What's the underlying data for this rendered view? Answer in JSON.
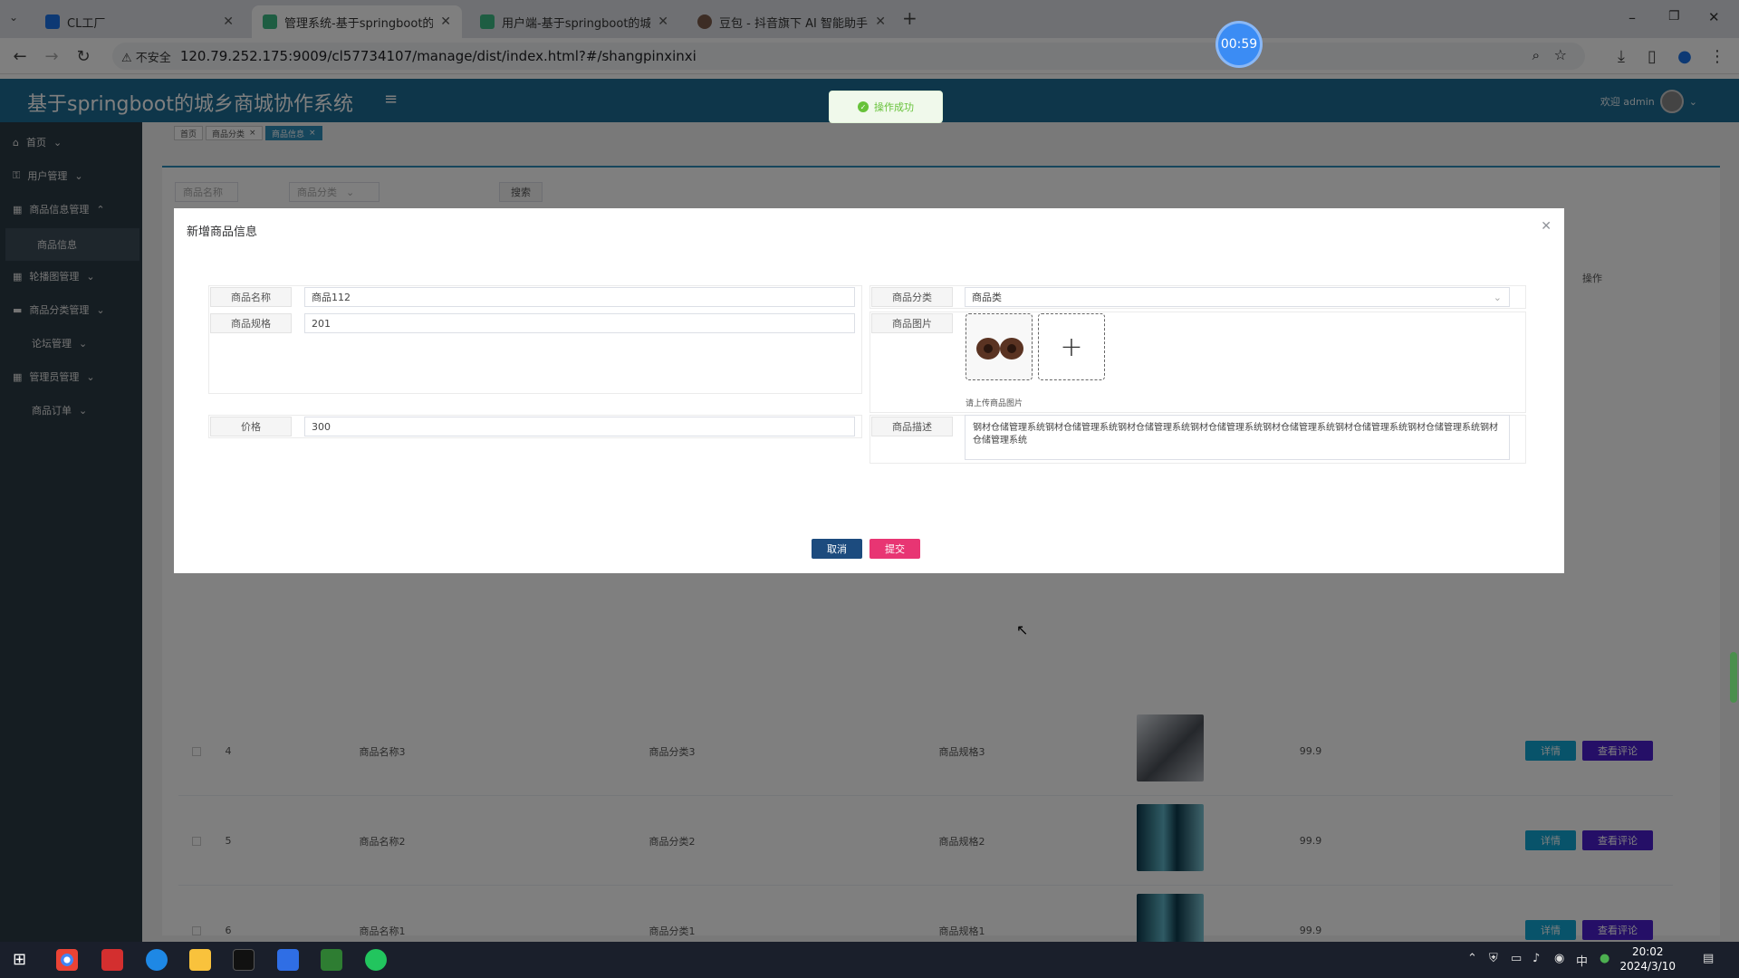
{
  "browser": {
    "tabs": [
      {
        "title": "CL工厂",
        "active": false
      },
      {
        "title": "管理系统-基于springboot的城",
        "active": true
      },
      {
        "title": "用户端-基于springboot的城乡",
        "active": false
      },
      {
        "title": "豆包 - 抖音旗下 AI 智能助手",
        "active": false
      }
    ],
    "security_label": "不安全",
    "url": "120.79.252.175:9009/cl57734107/manage/dist/index.html?#/shangpinxinxi",
    "timer": "00:59"
  },
  "app": {
    "title": "基于springboot的城乡商城协作系统",
    "welcome": "欢迎 admin"
  },
  "toast": {
    "message": "操作成功"
  },
  "sidebar": {
    "items": [
      {
        "label": "首页"
      },
      {
        "label": "用户管理"
      },
      {
        "label": "商品信息管理"
      },
      {
        "label": "商品信息"
      },
      {
        "label": "轮播图管理"
      },
      {
        "label": "商品分类管理"
      },
      {
        "label": "论坛管理"
      },
      {
        "label": "管理员管理"
      },
      {
        "label": "商品订单"
      }
    ]
  },
  "breadcrumbs": [
    "首页",
    "商品分类",
    "商品信息"
  ],
  "search": {
    "name_placeholder": "商品名称",
    "category_placeholder": "商品分类",
    "button": "搜索"
  },
  "table": {
    "ops_header": "操作",
    "detail_label": "详情",
    "comment_label": "查看评论",
    "rows": [
      {
        "idx": "4",
        "name": "商品名称3",
        "category": "商品分类3",
        "spec": "商品规格3",
        "price": "99.9"
      },
      {
        "idx": "5",
        "name": "商品名称2",
        "category": "商品分类2",
        "spec": "商品规格2",
        "price": "99.9"
      },
      {
        "idx": "6",
        "name": "商品名称1",
        "category": "商品分类1",
        "spec": "商品规格1",
        "price": "99.9"
      }
    ]
  },
  "dialog": {
    "title": "新增商品信息",
    "fields": {
      "name_label": "商品名称",
      "name_value": "商品112",
      "spec_label": "商品规格",
      "spec_value": "201",
      "price_label": "价格",
      "price_value": "300",
      "category_label": "商品分类",
      "category_value": "商品类",
      "image_label": "商品图片",
      "image_hint": "请上传商品图片",
      "desc_label": "商品描述",
      "desc_value": "钢材仓储管理系统钢材仓储管理系统钢材仓储管理系统钢材仓储管理系统钢材仓储管理系统钢材仓储管理系统钢材仓储管理系统钢材仓储管理系统"
    },
    "cancel": "取消",
    "submit": "提交"
  },
  "taskbar": {
    "time": "20:02",
    "date": "2024/3/10",
    "ime": "中"
  },
  "colors": {
    "header": "#1d6d95",
    "sidebar": "#2b3a45",
    "detail_button": "#10a7d5",
    "comment_button": "#4b1ecf",
    "cancel_button": "#1c4b7e",
    "submit_button": "#e83573"
  }
}
